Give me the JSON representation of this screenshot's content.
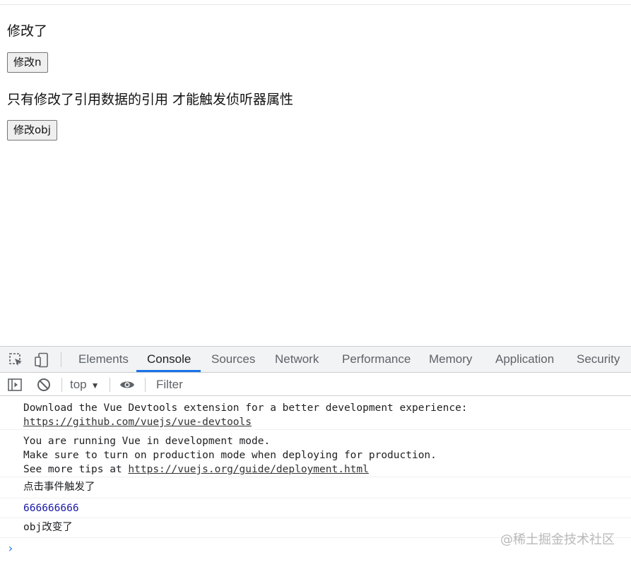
{
  "page": {
    "line1": "修改了",
    "button_n": "修改n",
    "line2": "只有修改了引用数据的引用 才能触发侦听器属性",
    "button_obj": "修改obj"
  },
  "devtools": {
    "tabs": [
      "Elements",
      "Console",
      "Sources",
      "Network",
      "Performance",
      "Memory",
      "Application",
      "Security"
    ],
    "active_tab": "Console",
    "context": "top",
    "filter_placeholder": "Filter",
    "messages": {
      "m1_line1": "Download the Vue Devtools extension for a better development experience:",
      "m1_link": "https://github.com/vuejs/vue-devtools",
      "m2_line1": "You are running Vue in development mode.",
      "m2_line2": "Make sure to turn on production mode when deploying for production.",
      "m2_line3_prefix": "See more tips at ",
      "m2_link": "https://vuejs.org/guide/deployment.html",
      "m3": "点击事件触发了",
      "m4": "666666666",
      "m5": "obj改变了"
    },
    "prompt": "›"
  },
  "watermark": "@稀土掘金技术社区",
  "colors": {
    "accent": "#1a73e8",
    "number": "#1a1aa6",
    "toolbar_bg": "#f1f3f4"
  },
  "icons": [
    "inspect-element-icon",
    "device-toolbar-icon",
    "sidebar-toggle-icon",
    "clear-console-icon",
    "eye-icon"
  ]
}
